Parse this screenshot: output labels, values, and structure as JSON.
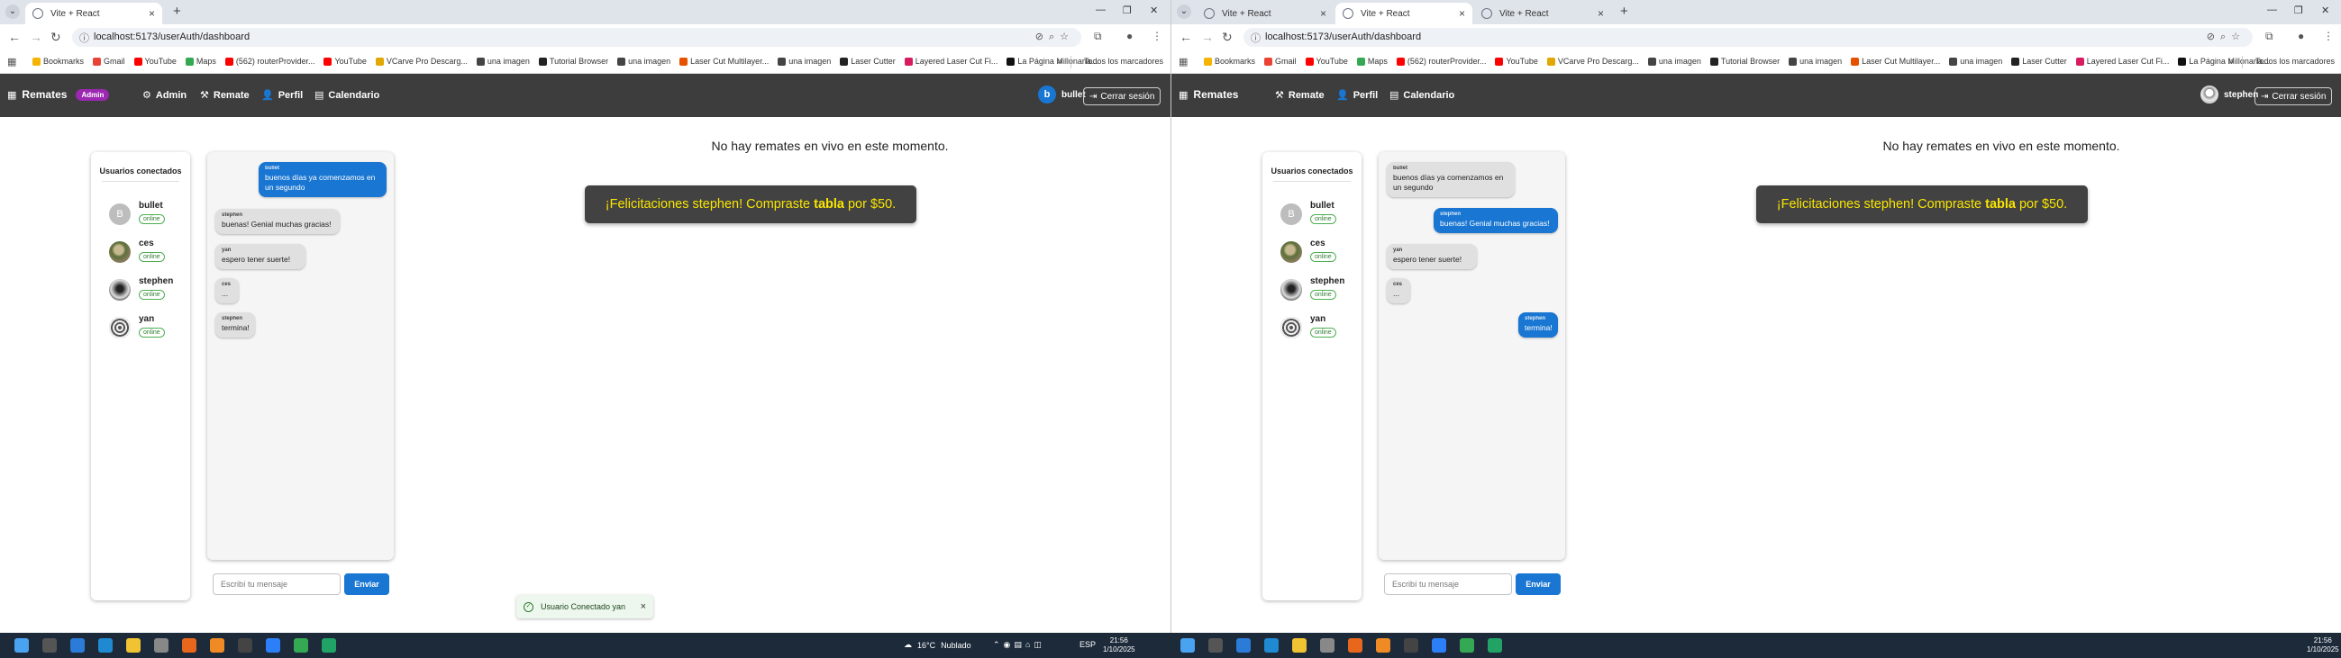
{
  "browser": {
    "tab_title": "Vite + React",
    "url": "localhost:5173/userAuth/dashboard",
    "bookmarks": [
      {
        "label": "Bookmarks",
        "color": "#f6b400"
      },
      {
        "label": "Gmail",
        "color": "#ea4335"
      },
      {
        "label": "YouTube",
        "color": "#ff0000"
      },
      {
        "label": "Maps",
        "color": "#34a853"
      },
      {
        "label": "(562) routerProvider...",
        "color": "#ff0000"
      },
      {
        "label": "YouTube",
        "color": "#ff0000"
      },
      {
        "label": "VCarve Pro Descarg...",
        "color": "#e0a800"
      },
      {
        "label": "una imagen",
        "color": "#444444"
      },
      {
        "label": "Tutorial Browser",
        "color": "#222222"
      },
      {
        "label": "una imagen",
        "color": "#444444"
      },
      {
        "label": "Laser Cut Multilayer...",
        "color": "#e65100"
      },
      {
        "label": "una imagen",
        "color": "#444444"
      },
      {
        "label": "Laser Cutter",
        "color": "#222222"
      },
      {
        "label": "Layered Laser Cut Fi...",
        "color": "#d81b60"
      },
      {
        "label": "La Página Millonaria...",
        "color": "#111111"
      }
    ],
    "all_bookmarks": "Todos los marcadores"
  },
  "app": {
    "brand": "Remates",
    "admin_badge": "Admin",
    "nav": {
      "admin": "Admin",
      "remate": "Remate",
      "perfil": "Perfil",
      "calendario": "Calendario"
    },
    "logout": "Cerrar sesión"
  },
  "users_panel": {
    "title": "Usuarios conectados",
    "users": [
      {
        "name": "bullet",
        "status": "online",
        "initial": "B"
      },
      {
        "name": "ces",
        "status": "online"
      },
      {
        "name": "stephen",
        "status": "online"
      },
      {
        "name": "yan",
        "status": "online"
      }
    ]
  },
  "left": {
    "user": {
      "name": "bullet",
      "initial": "b"
    },
    "messages": [
      {
        "from": "bullet",
        "text": "buenos días ya comenzamos en un segundo"
      },
      {
        "from": "stephen",
        "text": "buenas! Genial muchas gracias!"
      },
      {
        "from": "yan",
        "text": "espero tener suerte!"
      },
      {
        "from": "ces",
        "text": "..."
      },
      {
        "from": "stephen",
        "text": "termina!"
      }
    ],
    "toast": "Usuario Conectado yan"
  },
  "right": {
    "user": {
      "name": "stephen"
    },
    "messages": [
      {
        "from": "bullet",
        "text": "buenos días ya comenzamos en un segundo"
      },
      {
        "from": "stephen",
        "text": "buenas! Genial muchas gracias!"
      },
      {
        "from": "yan",
        "text": "espero tener suerte!"
      },
      {
        "from": "ces",
        "text": "..."
      },
      {
        "from": "stephen",
        "text": "termina!"
      }
    ]
  },
  "chat": {
    "placeholder": "Escribí tu mensaje",
    "send": "Enviar"
  },
  "main": {
    "no_auctions": "No hay remates en vivo en este momento.",
    "congrats_pre": "¡Felicitaciones stephen! Compraste ",
    "congrats_item": "tabla",
    "congrats_post": " por $50."
  },
  "taskbar": {
    "weather_temp": "16°C",
    "weather_desc": "Nublado",
    "lang": "ESP",
    "time": "21:56",
    "date": "1/10/2025"
  }
}
